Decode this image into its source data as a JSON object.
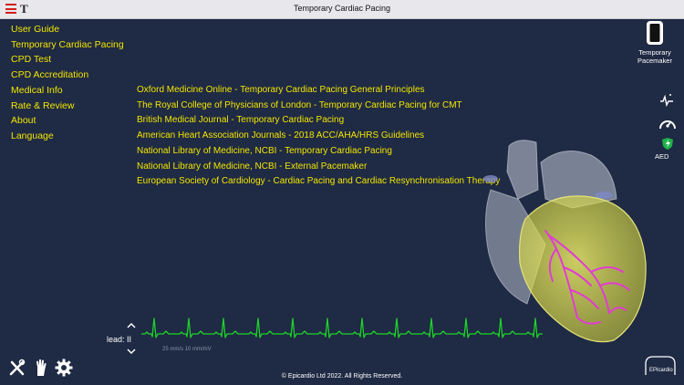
{
  "header": {
    "title": "Temporary Cardiac Pacing",
    "menu_icon": "hamburger-icon",
    "text_icon": "T"
  },
  "nav": {
    "items": [
      {
        "label": "User Guide"
      },
      {
        "label": "Temporary Cardiac Pacing"
      },
      {
        "label": "CPD Test"
      },
      {
        "label": "CPD Accreditation"
      },
      {
        "label": "Medical Info"
      },
      {
        "label": "Rate & Review"
      },
      {
        "label": "About"
      },
      {
        "label": "Language"
      }
    ]
  },
  "medical_links": {
    "items": [
      {
        "label": "Oxford Medicine Online - Temporary Cardiac Pacing General Principles"
      },
      {
        "label": "The Royal College of Physicians of London - Temporary Cardiac Pacing for CMT"
      },
      {
        "label": "British Medical Journal - Temporary Cardiac Pacing"
      },
      {
        "label": "American Heart Association Journals - 2018 ACC/AHA/HRS Guidelines"
      },
      {
        "label": "National Library of Medicine, NCBI - Temporary Cardiac Pacing"
      },
      {
        "label": "National Library of Medicine, NCBI - External Pacemaker"
      },
      {
        "label": "European Society of Cardiology - Cardiac Pacing and Cardiac Resynchronisation Therapy"
      }
    ]
  },
  "right_panel": {
    "pacemaker_label_1": "Temporary",
    "pacemaker_label_2": "Pacemaker",
    "aed_label": "AED"
  },
  "ecg": {
    "lead_label": "lead: II",
    "scale_text": "25 mm/s  10 mm/mV",
    "trace_color": "#1ed32a"
  },
  "footer": {
    "copyright": "© Epicardio Ltd 2022. All Rights Reserved.",
    "logo_text": "EPicardio"
  },
  "colors": {
    "background": "#1f2a44",
    "menu_text": "#f2e600",
    "titlebar": "#e8e8ec"
  }
}
